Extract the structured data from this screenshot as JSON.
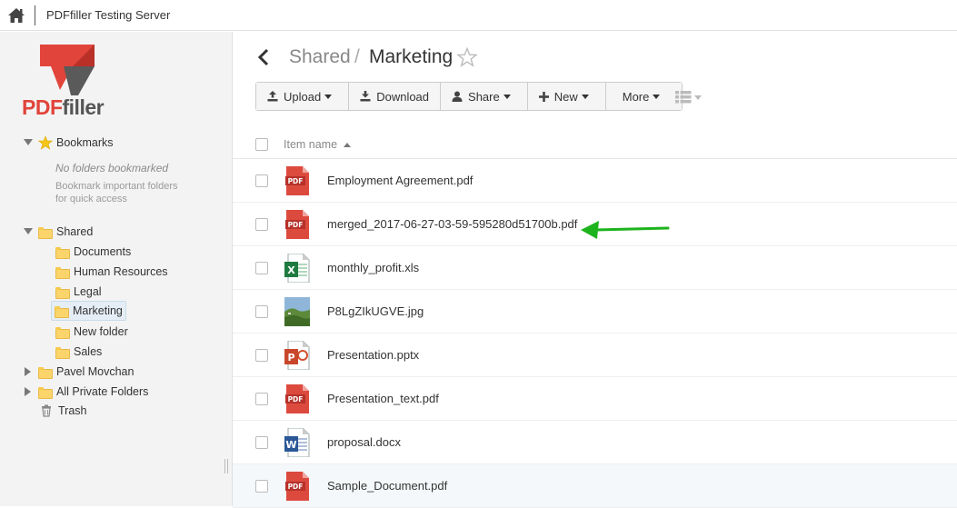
{
  "header": {
    "title": "PDFfiller Testing Server",
    "home_icon": "home-icon"
  },
  "brand": {
    "logo_pdf": "PDF",
    "logo_filler": "filler",
    "accent": "#e1443a"
  },
  "sidebar": {
    "bookmarks_label": "Bookmarks",
    "bookmarks_empty_title": "No folders bookmarked",
    "bookmarks_empty_hint": "Bookmark important folders for quick access",
    "shared_label": "Shared",
    "shared_children": [
      "Documents",
      "Human Resources",
      "Legal",
      "Marketing",
      "New folder",
      "Sales"
    ],
    "selected": "Marketing",
    "pavel_label": "Pavel Movchan",
    "private_label": "All Private Folders",
    "trash_label": "Trash"
  },
  "main": {
    "breadcrumb": {
      "parent": "Shared",
      "separator": "/",
      "current": "Marketing"
    },
    "toolbar": {
      "upload": "Upload",
      "download": "Download",
      "share": "Share",
      "new": "New",
      "more": "More"
    },
    "list_header": {
      "name": "Item name"
    },
    "files": [
      {
        "name": "Employment Agreement.pdf",
        "type": "pdf"
      },
      {
        "name": "merged_2017-06-27-03-59-595280d51700b.pdf",
        "type": "pdf"
      },
      {
        "name": "monthly_profit.xls",
        "type": "xls"
      },
      {
        "name": "P8LgZIkUGVE.jpg",
        "type": "jpg"
      },
      {
        "name": "Presentation.pptx",
        "type": "pptx"
      },
      {
        "name": "Presentation_text.pdf",
        "type": "pdf"
      },
      {
        "name": "proposal.docx",
        "type": "docx"
      },
      {
        "name": "Sample_Document.pdf",
        "type": "pdf"
      }
    ],
    "annotation_color": "#1db31d"
  }
}
